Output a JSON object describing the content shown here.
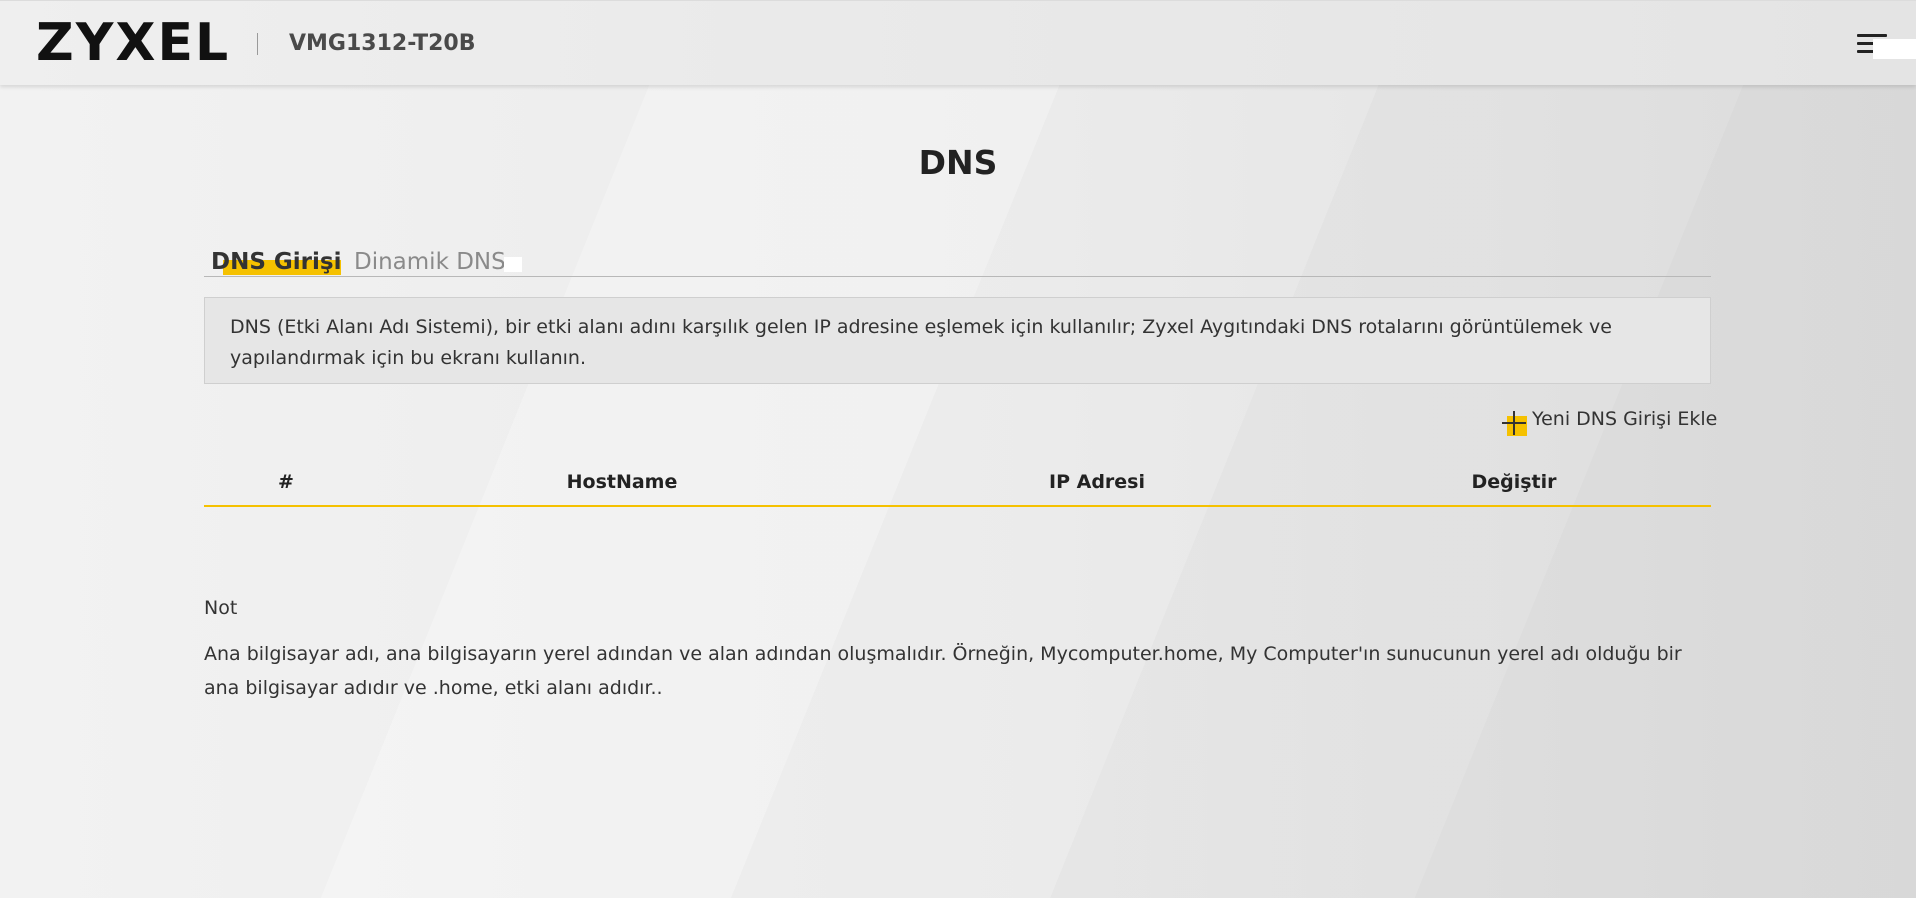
{
  "header": {
    "brand": "ZYXEL",
    "model": "VMG1312-T20B"
  },
  "page": {
    "title": "DNS"
  },
  "tabs": [
    {
      "label": "DNS Girişi",
      "active": true
    },
    {
      "label": "Dinamik DNS",
      "active": false
    }
  ],
  "info": {
    "text": "DNS (Etki Alanı Adı Sistemi), bir etki alanı adını karşılık gelen IP adresine eşlemek için kullanılır; Zyxel Aygıtındaki DNS rotalarını görüntülemek ve yapılandırmak için bu ekranı kullanın."
  },
  "actions": {
    "add_entry_label": "Yeni DNS Girişi Ekle"
  },
  "table": {
    "columns": [
      "#",
      "HostName",
      "IP Adresi",
      "Değiştir"
    ],
    "rows": []
  },
  "note": {
    "title": "Not",
    "text": "Ana bilgisayar adı, ana bilgisayarın yerel adından ve alan adından oluşmalıdır. Örneğin, Mycomputer.home, My Computer'ın sunucunun yerel adı olduğu bir ana bilgisayar adıdır ve .home, etki alanı adıdır.."
  },
  "colors": {
    "accent": "#f5c100",
    "text": "#333333",
    "info_bg": "#e6e6e6"
  },
  "icons": {
    "menu": "hamburger-menu-icon",
    "add": "plus-icon"
  }
}
